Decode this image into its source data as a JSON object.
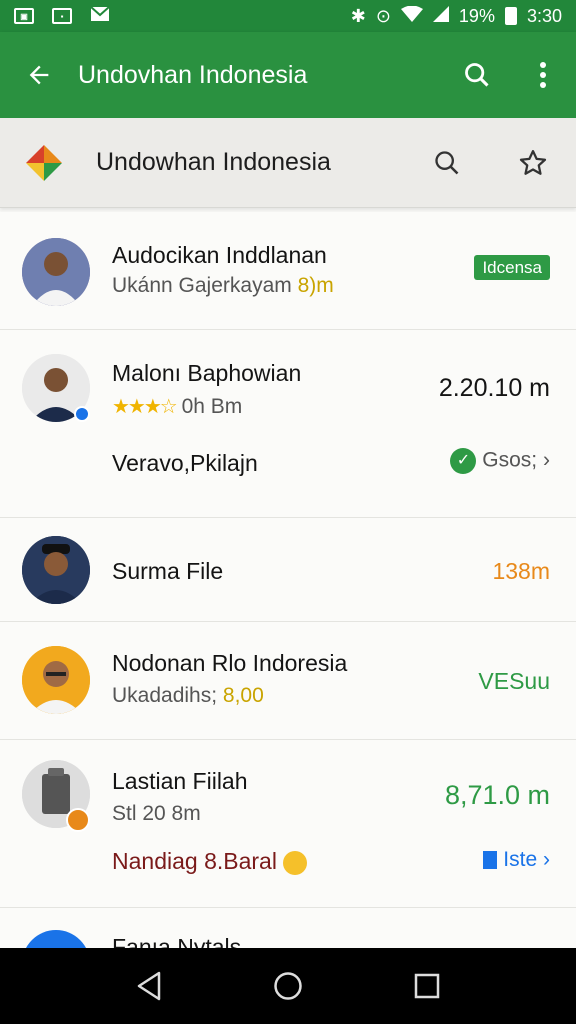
{
  "status_bar": {
    "battery": "19%",
    "time": "3:30"
  },
  "appbar": {
    "title": "Undovhan Indonesia"
  },
  "subheader": {
    "title": "Undowhan Indonesia"
  },
  "colors": {
    "primary": "#2a9140",
    "status": "#22873a",
    "accent_orange": "#e8891a",
    "accent_green": "#2e9a45",
    "accent_blue": "#1a73e8",
    "dark_red": "#7a1a1a"
  },
  "rows": [
    {
      "name": "Audocikan Inddlanan",
      "sub": "Ukánn Gajerkayam",
      "sub_extra": "8)m",
      "badge": "Idcensa"
    },
    {
      "name": "Malonı Baphowian",
      "rating": "★★★☆",
      "sub": "0h Bm",
      "value": "2.20.10 m",
      "line3": "Veravo,Pkilajn",
      "status": "Gsos;"
    },
    {
      "name": "Surma File",
      "value": "138m"
    },
    {
      "name": "Nodonan Rlo Indoresia",
      "sub": "Ukadadihs; ",
      "sub_extra": "8,00",
      "value": "VESuu"
    },
    {
      "name": "Lastian Fiilah",
      "sub": "Stl 20 8m",
      "value": "8,71.0 m",
      "line3": "Nandiag 8.Baral",
      "status": "Iste"
    },
    {
      "name": "Fanıa Nytals"
    }
  ]
}
